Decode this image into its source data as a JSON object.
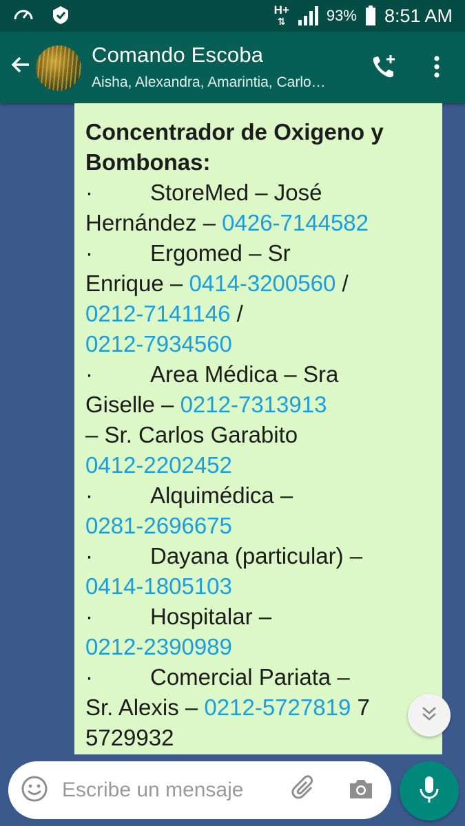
{
  "status_bar": {
    "network": "H+",
    "battery_percent": "93%",
    "time": "8:51 AM",
    "icons": [
      "speedometer-icon",
      "shield-icon",
      "network-type-icon",
      "signal-icon",
      "battery-icon"
    ]
  },
  "header": {
    "title": "Comando Escoba",
    "members": "Aisha, Alexandra, Amarintia, Carlo…",
    "icons": [
      "back-arrow-icon",
      "group-avatar",
      "add-call-icon",
      "more-vert-icon"
    ]
  },
  "message": {
    "title_line1": "Concentrador de Oxigeno y",
    "title_line2": "Bombonas:",
    "bullet": "·",
    "items": [
      {
        "l1": "StoreMed – José",
        "l2": "Hernández – ",
        "p1": "0426-7144582"
      },
      {
        "l1": "Ergomed – Sr",
        "l2": "Enrique – ",
        "p1": "0414-3200560",
        "sep": " /",
        "p2": "0212-7141146",
        "p3": "0212-7934560"
      },
      {
        "l1": "Area Médica – Sra",
        "l2": "Giselle – ",
        "p1": "0212-7313913",
        "l3": "– Sr. Carlos Garabito",
        "p2": "0412-2202452"
      },
      {
        "l1": "Alquimédica –",
        "p1": "0281-2696675"
      },
      {
        "l1": "Dayana (particular) –",
        "p1": "0414-1805103"
      },
      {
        "l1": "Hospitalar –",
        "p1": "0212-2390989"
      },
      {
        "l1": "Comercial Pariata –",
        "l2": "Sr. Alexis – ",
        "p1": "0212-5727819",
        "tail": " 7",
        "l3": "5729932"
      }
    ]
  },
  "input": {
    "placeholder": "Escribe un mensaje",
    "icons": [
      "emoji-icon",
      "paperclip-icon",
      "camera-icon",
      "mic-icon",
      "scroll-down-icon"
    ]
  },
  "colors": {
    "status_bar": "#054d44",
    "app_bar": "#075e54",
    "chat_bg": "#3b5a8c",
    "bubble": "#dcf8c6",
    "link": "#1a9ee0",
    "mic": "#00897b"
  }
}
